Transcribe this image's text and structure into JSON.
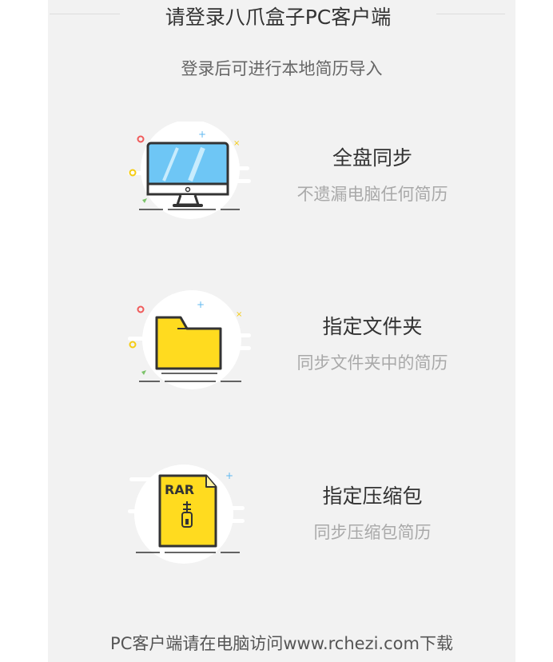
{
  "header": {
    "title": "请登录八爪盒子PC客户端",
    "subtitle": "登录后可进行本地简历导入"
  },
  "features": [
    {
      "icon": "monitor-icon",
      "title": "全盘同步",
      "desc": "不遗漏电脑任何简历"
    },
    {
      "icon": "folder-icon",
      "title": "指定文件夹",
      "desc": "同步文件夹中的简历"
    },
    {
      "icon": "rar-archive-icon",
      "title": "指定压缩包",
      "desc": "同步压缩包简历",
      "badge": "RAR"
    }
  ],
  "footer": {
    "text": "PC客户端请在电脑访问www.rchezi.com下载"
  },
  "colors": {
    "panel_bg": "#f2f2f2",
    "screen_blue": "#6ec6f5",
    "folder_yellow": "#ffdb1f",
    "accent_red": "#f05a5a",
    "accent_blue": "#5fb8f0"
  }
}
